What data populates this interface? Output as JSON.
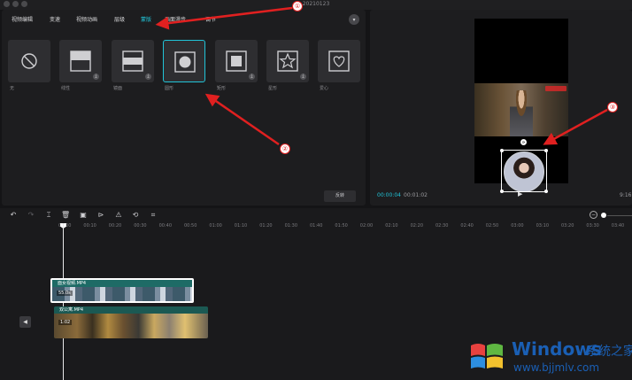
{
  "window": {
    "title": "20210123"
  },
  "left_panel": {
    "tabs": [
      {
        "label": "视频编辑",
        "active": false
      },
      {
        "label": "变速",
        "active": false
      },
      {
        "label": "视频动画",
        "active": false
      },
      {
        "label": "层级",
        "active": false
      },
      {
        "label": "蒙版",
        "active": true
      },
      {
        "label": "画面漫步",
        "active": false
      },
      {
        "label": "调节",
        "active": false
      }
    ],
    "collapse_icon": "chevron-down-icon",
    "masks": [
      {
        "label": "无",
        "icon": "none-icon",
        "download": false,
        "selected": false
      },
      {
        "label": "线性",
        "icon": "linear-mask-icon",
        "download": true,
        "selected": false
      },
      {
        "label": "镜面",
        "icon": "mirror-mask-icon",
        "download": true,
        "selected": false
      },
      {
        "label": "圆形",
        "icon": "circle-mask-icon",
        "download": false,
        "selected": true
      },
      {
        "label": "矩形",
        "icon": "rect-mask-icon",
        "download": true,
        "selected": false
      },
      {
        "label": "星形",
        "icon": "star-mask-icon",
        "download": true,
        "selected": false
      },
      {
        "label": "爱心",
        "icon": "heart-mask-icon",
        "download": false,
        "selected": false
      }
    ],
    "invert_label": "反转"
  },
  "player": {
    "current_time": "00:00:04",
    "duration": "00:01:02",
    "ratio": "9:16",
    "rotate_icon": "rotate-icon"
  },
  "timeline": {
    "ticks": [
      "00:00",
      "00:10",
      "00:20",
      "00:30",
      "00:40",
      "00:50",
      "01:00",
      "01:10",
      "01:20",
      "01:30",
      "01:40",
      "01:50",
      "02:00",
      "02:10",
      "02:20",
      "02:30",
      "02:40",
      "02:50",
      "03:00",
      "03:10",
      "03:20",
      "03:30",
      "03:40"
    ],
    "clips": [
      {
        "name": "面女视频.MP4",
        "duration": "55.0s"
      },
      {
        "name": "双公寓.MP4",
        "duration": "1:02"
      }
    ]
  },
  "annotations": {
    "marker1": "①",
    "marker2": "②",
    "marker3": "③"
  },
  "watermark": {
    "brand": "Windows",
    "cn": "系统之家",
    "url": "www.bjjmlv.com"
  },
  "colors": {
    "accent": "#21c4d8",
    "annotation": "#e02020",
    "panel": "#1d1d1f"
  }
}
